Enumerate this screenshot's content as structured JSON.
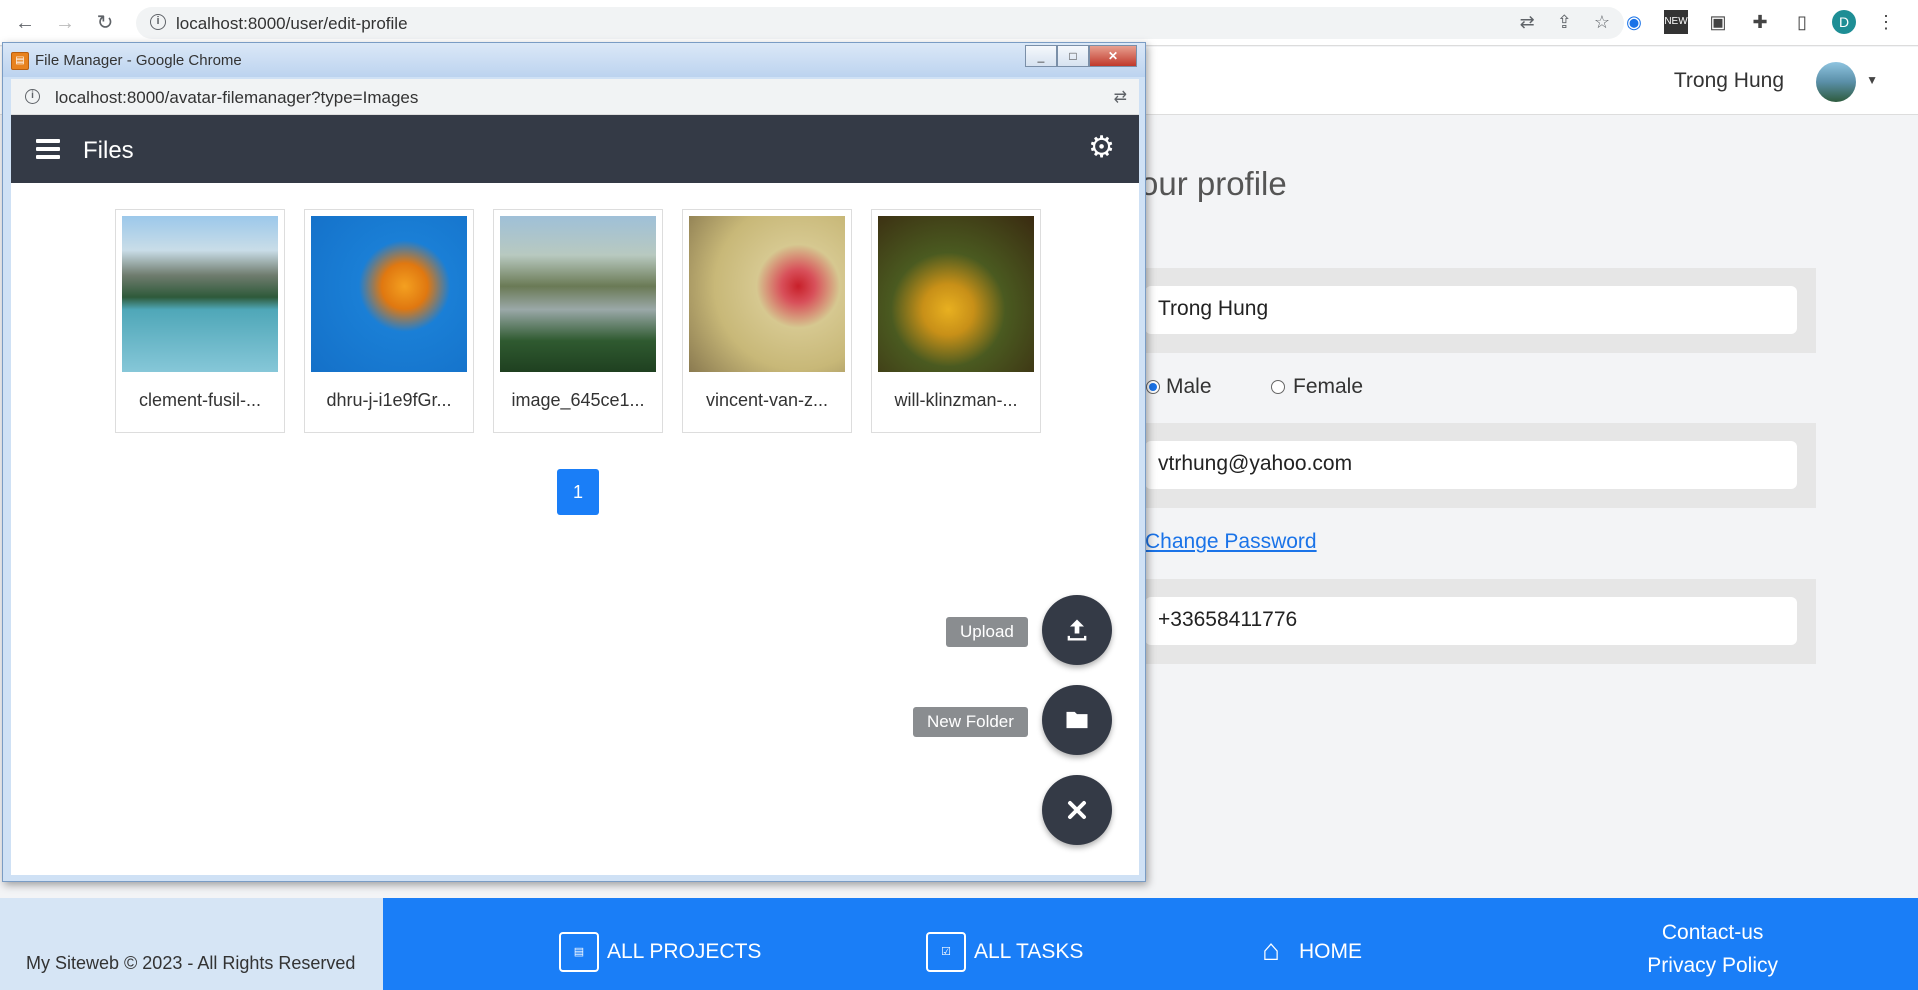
{
  "browser": {
    "url": "localhost:8000/user/edit-profile",
    "profile_initial": "D"
  },
  "page": {
    "user_name": "Trong Hung",
    "profile_title": "our profile",
    "full_name": "Trong Hung",
    "gender_options": [
      "Male",
      "Female"
    ],
    "email": "vtrhung@yahoo.com",
    "change_password": "Change Password",
    "phone": "+33658411776"
  },
  "footer": {
    "copyright": "My Siteweb © 2023 - All Rights Reserved",
    "all_projects": "ALL PROJECTS",
    "all_tasks": "ALL TASKS",
    "home": "HOME",
    "contact": "Contact-us",
    "privacy": "Privacy Policy"
  },
  "popup": {
    "window_title": "File Manager - Google Chrome",
    "url": "localhost:8000/avatar-filemanager?type=Images",
    "header_title": "Files",
    "files": [
      {
        "name": "clement-fusil-..."
      },
      {
        "name": "dhru-j-i1e9fGr..."
      },
      {
        "name": "image_645ce1..."
      },
      {
        "name": "vincent-van-z..."
      },
      {
        "name": "will-klinzman-..."
      }
    ],
    "pagination": [
      "1"
    ],
    "actions": {
      "upload": "Upload",
      "new_folder": "New Folder"
    }
  }
}
